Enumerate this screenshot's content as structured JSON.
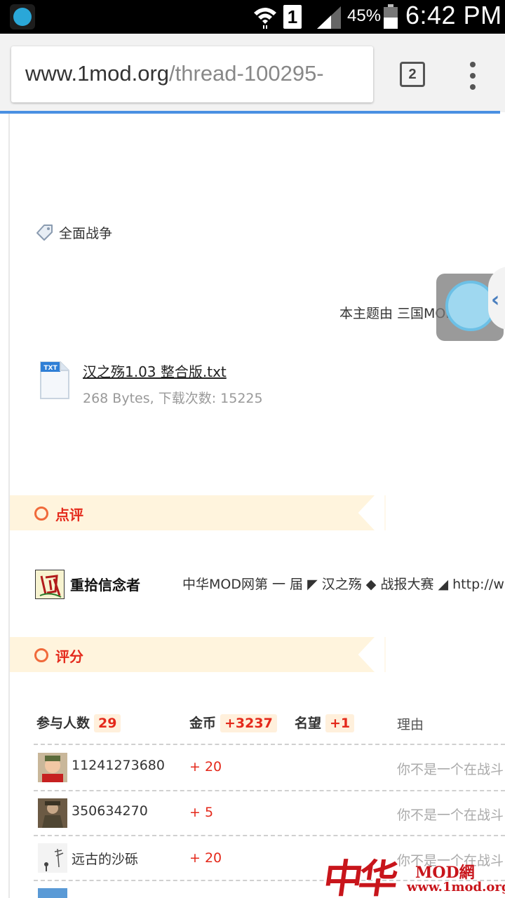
{
  "status_bar": {
    "battery_percent": "45%",
    "time": "6:42 PM",
    "sim_slot": "1",
    "app_icon": "app-notification-icon"
  },
  "browser": {
    "url_domain": "www.1mod.org",
    "url_path": "/thread-100295-",
    "tab_count": "2",
    "menu_icon": "more-vert-icon",
    "progress": 0.99
  },
  "content": {
    "tag_label": "全面战争",
    "thread_note": "本主题由 三国MOD组 引",
    "attachment": {
      "name": "汉之殇1.03 整合版.txt",
      "meta": "268 Bytes, 下载次数: 15225"
    },
    "comments_section": {
      "title": "点评",
      "comment": {
        "user": "重拾信念者",
        "text": "中华MOD网第 一 届 ◤ 汉之殇 ◆ 战报大赛 ◢ http://w"
      }
    },
    "rating_section": {
      "title": "评分",
      "headers": {
        "participants_label": "参与人数",
        "participants_count": "29",
        "gold_label": "金币",
        "gold_total": "+3237",
        "fame_label": "名望",
        "fame_total": "+1",
        "reason_label": "理由"
      },
      "rows": [
        {
          "user": "11241273680",
          "gold": "+ 20",
          "reason": "你不是一个在战斗"
        },
        {
          "user": "350634270",
          "gold": "+ 5",
          "reason": "你不是一个在战斗"
        },
        {
          "user": "远古的沙砾",
          "gold": "+ 20",
          "reason": "你不是一个在战斗"
        }
      ]
    }
  },
  "watermark": {
    "cn": "中华",
    "mod": "MOD網",
    "url": "www.1mod.org"
  },
  "colors": {
    "accent_red": "#e4291b",
    "banner_bg": "#fff4dd",
    "progress_blue": "#4a90e2"
  }
}
